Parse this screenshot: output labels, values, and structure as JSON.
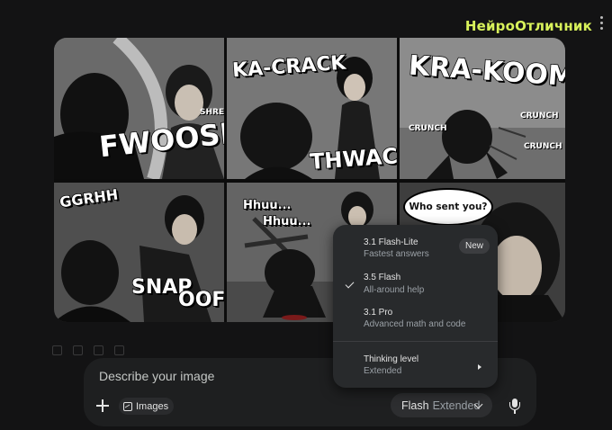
{
  "watermark": "НейроОтличник",
  "comic": {
    "sfx": {
      "fwoosh": "FWOOSH",
      "shrek": "SHREK",
      "kacrack": "KA-CRACK",
      "thwack": "THWACK",
      "kraboom": "KRA-KOOM",
      "crunch": "CRUNCH",
      "ggrhh": "GGRHH",
      "snap": "SNAP",
      "oof": "OOF",
      "hhuu1": "Hhuu...",
      "hhuu2": "Hhuu...",
      "who": "Who sent you?"
    }
  },
  "prompt": {
    "placeholder": "Describe your image",
    "images_chip": "Images",
    "model_label": "Flash",
    "model_mode": "Extended"
  },
  "menu": {
    "items": [
      {
        "title": "3.1 Flash-Lite",
        "subtitle": "Fastest answers",
        "badge": "New",
        "selected": false
      },
      {
        "title": "3.5 Flash",
        "subtitle": "All-around help",
        "selected": true
      },
      {
        "title": "3.1 Pro",
        "subtitle": "Advanced math and code",
        "selected": false
      }
    ],
    "thinking": {
      "title": "Thinking level",
      "subtitle": "Extended"
    }
  },
  "icons": [
    "kebab-menu-icon",
    "plus-icon",
    "image-icon",
    "chevron-down-icon",
    "mic-icon",
    "checkmark-icon",
    "chevron-right-icon"
  ]
}
